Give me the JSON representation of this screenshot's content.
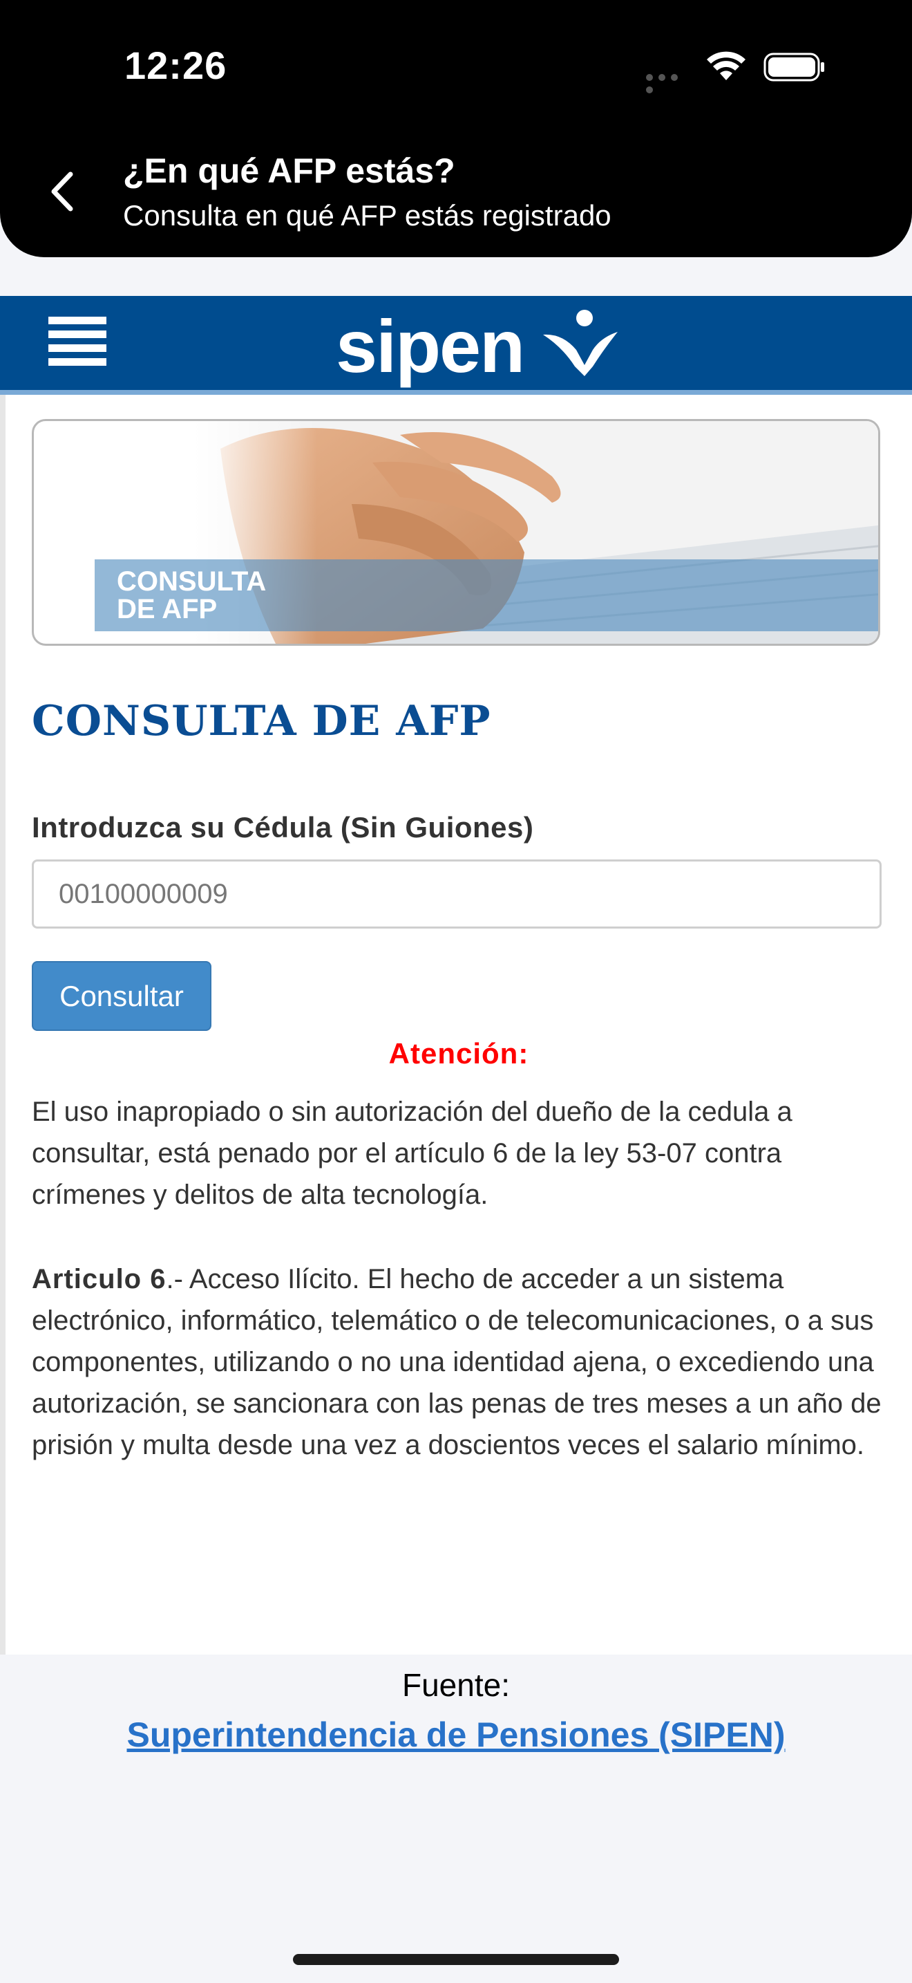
{
  "status_bar": {
    "time": "12:26"
  },
  "nav": {
    "title": "¿En qué AFP estás?",
    "subtitle": "Consulta en qué AFP estás registrado"
  },
  "site": {
    "logo_text": "sipen",
    "brand_color": "#004c8f",
    "banner_label_line1": "CONSULTA",
    "banner_label_line2": "DE AFP"
  },
  "form": {
    "heading": "CONSULTA DE AFP",
    "field_label": "Introduzca su Cédula (Sin Guiones)",
    "cedula_placeholder": "00100000009",
    "submit_label": "Consultar"
  },
  "notice": {
    "attention_label": "Atención:",
    "warning": "El uso inapropiado o sin autorización del dueño de la cedula a consultar, está penado por el artículo 6 de la ley 53-07 contra crímenes y delitos de alta tecnología.",
    "article_title": "Articulo 6",
    "article_body": ".- Acceso Ilícito. El hecho de acceder a un sistema electrónico, informático, telemático o de telecomunicaciones, o a sus componentes, utilizando o no una identidad ajena, o excediendo una autorización, se sancionara con las penas de tres meses a un año de prisión y multa desde una vez a doscientos veces el salario mínimo."
  },
  "footer": {
    "source_label": "Fuente:",
    "source_link": "Superintendencia de Pensiones (SIPEN)"
  }
}
